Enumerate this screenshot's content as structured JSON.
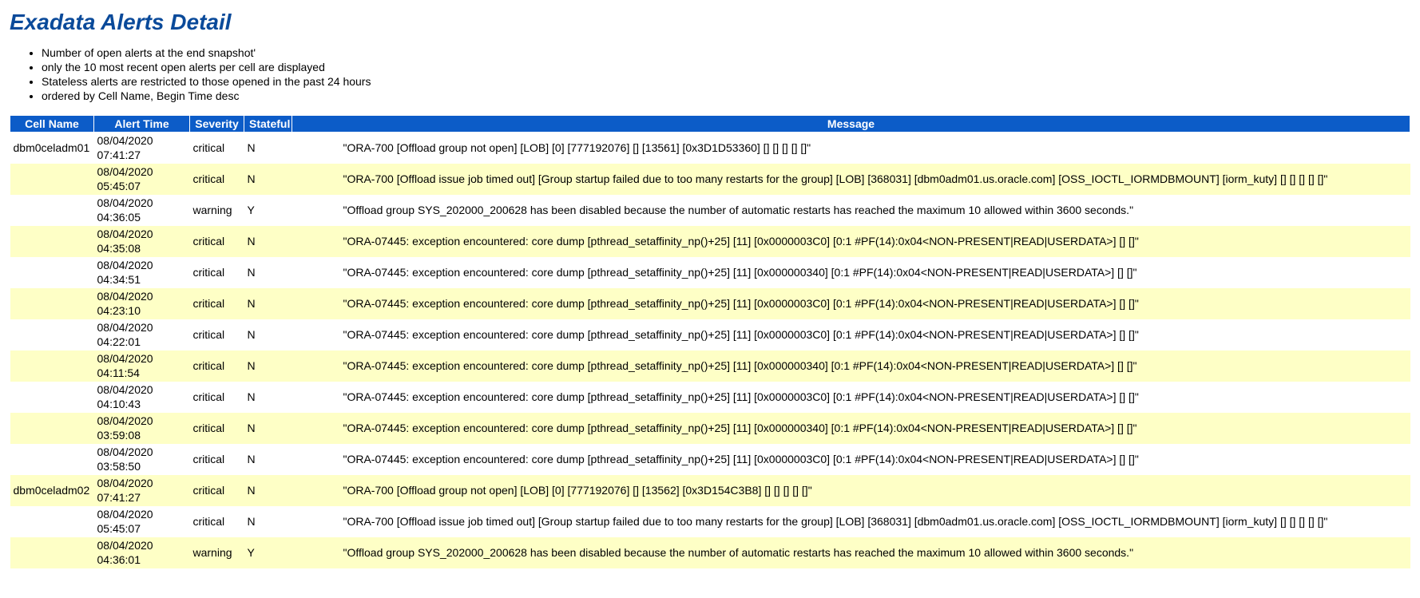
{
  "title": "Exadata Alerts Detail",
  "notes": [
    "Number of open alerts at the end snapshot'",
    "only the 10 most recent open alerts per cell are displayed",
    "Stateless alerts are restricted to those opened in the past 24 hours",
    "ordered by Cell Name, Begin Time desc"
  ],
  "columns": {
    "cell": "Cell Name",
    "time": "Alert Time",
    "severity": "Severity",
    "stateful": "Stateful",
    "message": "Message"
  },
  "rows": [
    {
      "cell": "dbm0celadm01",
      "time": "08/04/2020 07:41:27",
      "severity": "critical",
      "stateful": "N",
      "message": "\"ORA-700 [Offload group not open] [LOB] [0] [777192076] [] [13561] [0x3D1D53360] [] [] [] [] []\""
    },
    {
      "cell": "",
      "time": "08/04/2020 05:45:07",
      "severity": "critical",
      "stateful": "N",
      "message": "\"ORA-700 [Offload issue job timed out] [Group startup failed due to too many restarts for the group] [LOB] [368031] [dbm0adm01.us.oracle.com] [OSS_IOCTL_IORMDBMOUNT] [iorm_kuty] [] [] [] [] []\""
    },
    {
      "cell": "",
      "time": "08/04/2020 04:36:05",
      "severity": "warning",
      "stateful": "Y",
      "message": "\"Offload group SYS_202000_200628 has been disabled because the number of automatic restarts has reached the maximum 10 allowed within 3600 seconds.\""
    },
    {
      "cell": "",
      "time": "08/04/2020 04:35:08",
      "severity": "critical",
      "stateful": "N",
      "message": "\"ORA-07445: exception encountered: core dump [pthread_setaffinity_np()+25] [11] [0x0000003C0] [0:1 #PF(14):0x04<NON-PRESENT|READ|USERDATA>] [] []\""
    },
    {
      "cell": "",
      "time": "08/04/2020 04:34:51",
      "severity": "critical",
      "stateful": "N",
      "message": "\"ORA-07445: exception encountered: core dump [pthread_setaffinity_np()+25] [11] [0x000000340] [0:1 #PF(14):0x04<NON-PRESENT|READ|USERDATA>] [] []\""
    },
    {
      "cell": "",
      "time": "08/04/2020 04:23:10",
      "severity": "critical",
      "stateful": "N",
      "message": "\"ORA-07445: exception encountered: core dump [pthread_setaffinity_np()+25] [11] [0x0000003C0] [0:1 #PF(14):0x04<NON-PRESENT|READ|USERDATA>] [] []\""
    },
    {
      "cell": "",
      "time": "08/04/2020 04:22:01",
      "severity": "critical",
      "stateful": "N",
      "message": "\"ORA-07445: exception encountered: core dump [pthread_setaffinity_np()+25] [11] [0x0000003C0] [0:1 #PF(14):0x04<NON-PRESENT|READ|USERDATA>] [] []\""
    },
    {
      "cell": "",
      "time": "08/04/2020 04:11:54",
      "severity": "critical",
      "stateful": "N",
      "message": "\"ORA-07445: exception encountered: core dump [pthread_setaffinity_np()+25] [11] [0x000000340] [0:1 #PF(14):0x04<NON-PRESENT|READ|USERDATA>] [] []\""
    },
    {
      "cell": "",
      "time": "08/04/2020 04:10:43",
      "severity": "critical",
      "stateful": "N",
      "message": "\"ORA-07445: exception encountered: core dump [pthread_setaffinity_np()+25] [11] [0x0000003C0] [0:1 #PF(14):0x04<NON-PRESENT|READ|USERDATA>] [] []\""
    },
    {
      "cell": "",
      "time": "08/04/2020 03:59:08",
      "severity": "critical",
      "stateful": "N",
      "message": "\"ORA-07445: exception encountered: core dump [pthread_setaffinity_np()+25] [11] [0x000000340] [0:1 #PF(14):0x04<NON-PRESENT|READ|USERDATA>] [] []\""
    },
    {
      "cell": "",
      "time": "08/04/2020 03:58:50",
      "severity": "critical",
      "stateful": "N",
      "message": "\"ORA-07445: exception encountered: core dump [pthread_setaffinity_np()+25] [11] [0x0000003C0] [0:1 #PF(14):0x04<NON-PRESENT|READ|USERDATA>] [] []\""
    },
    {
      "cell": "dbm0celadm02",
      "time": "08/04/2020 07:41:27",
      "severity": "critical",
      "stateful": "N",
      "message": "\"ORA-700 [Offload group not open] [LOB] [0] [777192076] [] [13562] [0x3D154C3B8] [] [] [] [] []\""
    },
    {
      "cell": "",
      "time": "08/04/2020 05:45:07",
      "severity": "critical",
      "stateful": "N",
      "message": "\"ORA-700 [Offload issue job timed out] [Group startup failed due to too many restarts for the group] [LOB] [368031] [dbm0adm01.us.oracle.com] [OSS_IOCTL_IORMDBMOUNT] [iorm_kuty] [] [] [] [] []\""
    },
    {
      "cell": "",
      "time": "08/04/2020 04:36:01",
      "severity": "warning",
      "stateful": "Y",
      "message": "\"Offload group SYS_202000_200628 has been disabled because the number of automatic restarts has reached the maximum 10 allowed within 3600 seconds.\""
    }
  ]
}
